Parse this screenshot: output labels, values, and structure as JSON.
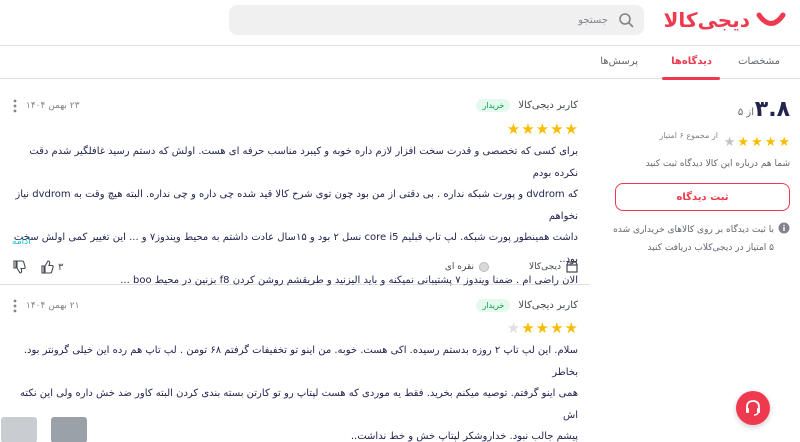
{
  "header": {
    "logo_text": "دیجی‌کالا",
    "search_placeholder": "جستجو",
    "brand_color": "#ef394e"
  },
  "tabs": [
    {
      "label": "مشخصات",
      "active": false
    },
    {
      "label": "دیدگاه‌ها",
      "active": true
    },
    {
      "label": "پرسش‌ها",
      "active": false
    }
  ],
  "summary": {
    "rating": "۳.۸",
    "rating_max": "از ۵",
    "stars_filled": 4,
    "stars_total": 5,
    "count_text": "از مجموع ۶ امتیاز",
    "hint": "شما هم درباره این کالا دیدگاه ثبت کنید",
    "submit_label": "ثبت دیدگاه",
    "info": "با ثبت دیدگاه بر روی کالاهای خریداری شده ۵ امتیاز در دیجی‌کلاب دریافت کنید",
    "info_icon": "info-icon"
  },
  "reviews": [
    {
      "user": "کاربر دیجی‌کالا",
      "badge": "خریدار",
      "date": "۲۳ بهمن ۱۴۰۴",
      "stars_filled": 5,
      "lines": [
        "برای کسی که تخصصی و قدرت سخت افزار لازم داره خوبه و کیبرد مناسب حرفه ای هست. اولش که دستم رسید غافلگیر شدم دقت نکرده بودم",
        "که dvdrom و پورت شبکه نداره . بی دقتی از من بود چون توی شرح کالا قید شده چی داره و چی نداره. البته هیچ وقت به dvdrom نیاز نخواهم",
        "داشت همینطور پورت شبکه. لپ تاپ قبلیم core i5 نسل ۲ بود و ۱۵سال عادت داشتم به محیط ویندوز۷ و ... این تغییر کمی اولش سخت بود..",
        "الان راضی ام . ضمنا ویندوز ۷ پشتیبانی نمیکنه و باید الیزنید و طریقشم روشن کردن f8 بزنین در محیط boo ..."
      ],
      "more_label": "ادامه",
      "seller": "دیجی‌کالا",
      "color": "نقره ای",
      "likes": "۳",
      "dislikes": ""
    },
    {
      "user": "کاربر دیجی‌کالا",
      "badge": "خریدار",
      "date": "۲۱ بهمن ۱۴۰۴",
      "stars_filled": 4,
      "lines": [
        "سلام. این لپ تاپ ۲ روزه بدستم رسیده. اکی هست. خوبه. من اینو تو تخفیفات گرفتم ۶۸ تومن . لپ تاپ هم رده این خیلی گرونتر بود. بخاطر",
        "همی اینو گرفتم. توصیه میکنم بخرید. فقط یه موردی که هست لپتاپ رو تو کارتن بسته بندی کردن البته کاور ضد خش داره ولی این نکته اش",
        "پیشم جالب نبود. خداروشکر لپتاپ خش و خط نداشت.."
      ]
    }
  ]
}
